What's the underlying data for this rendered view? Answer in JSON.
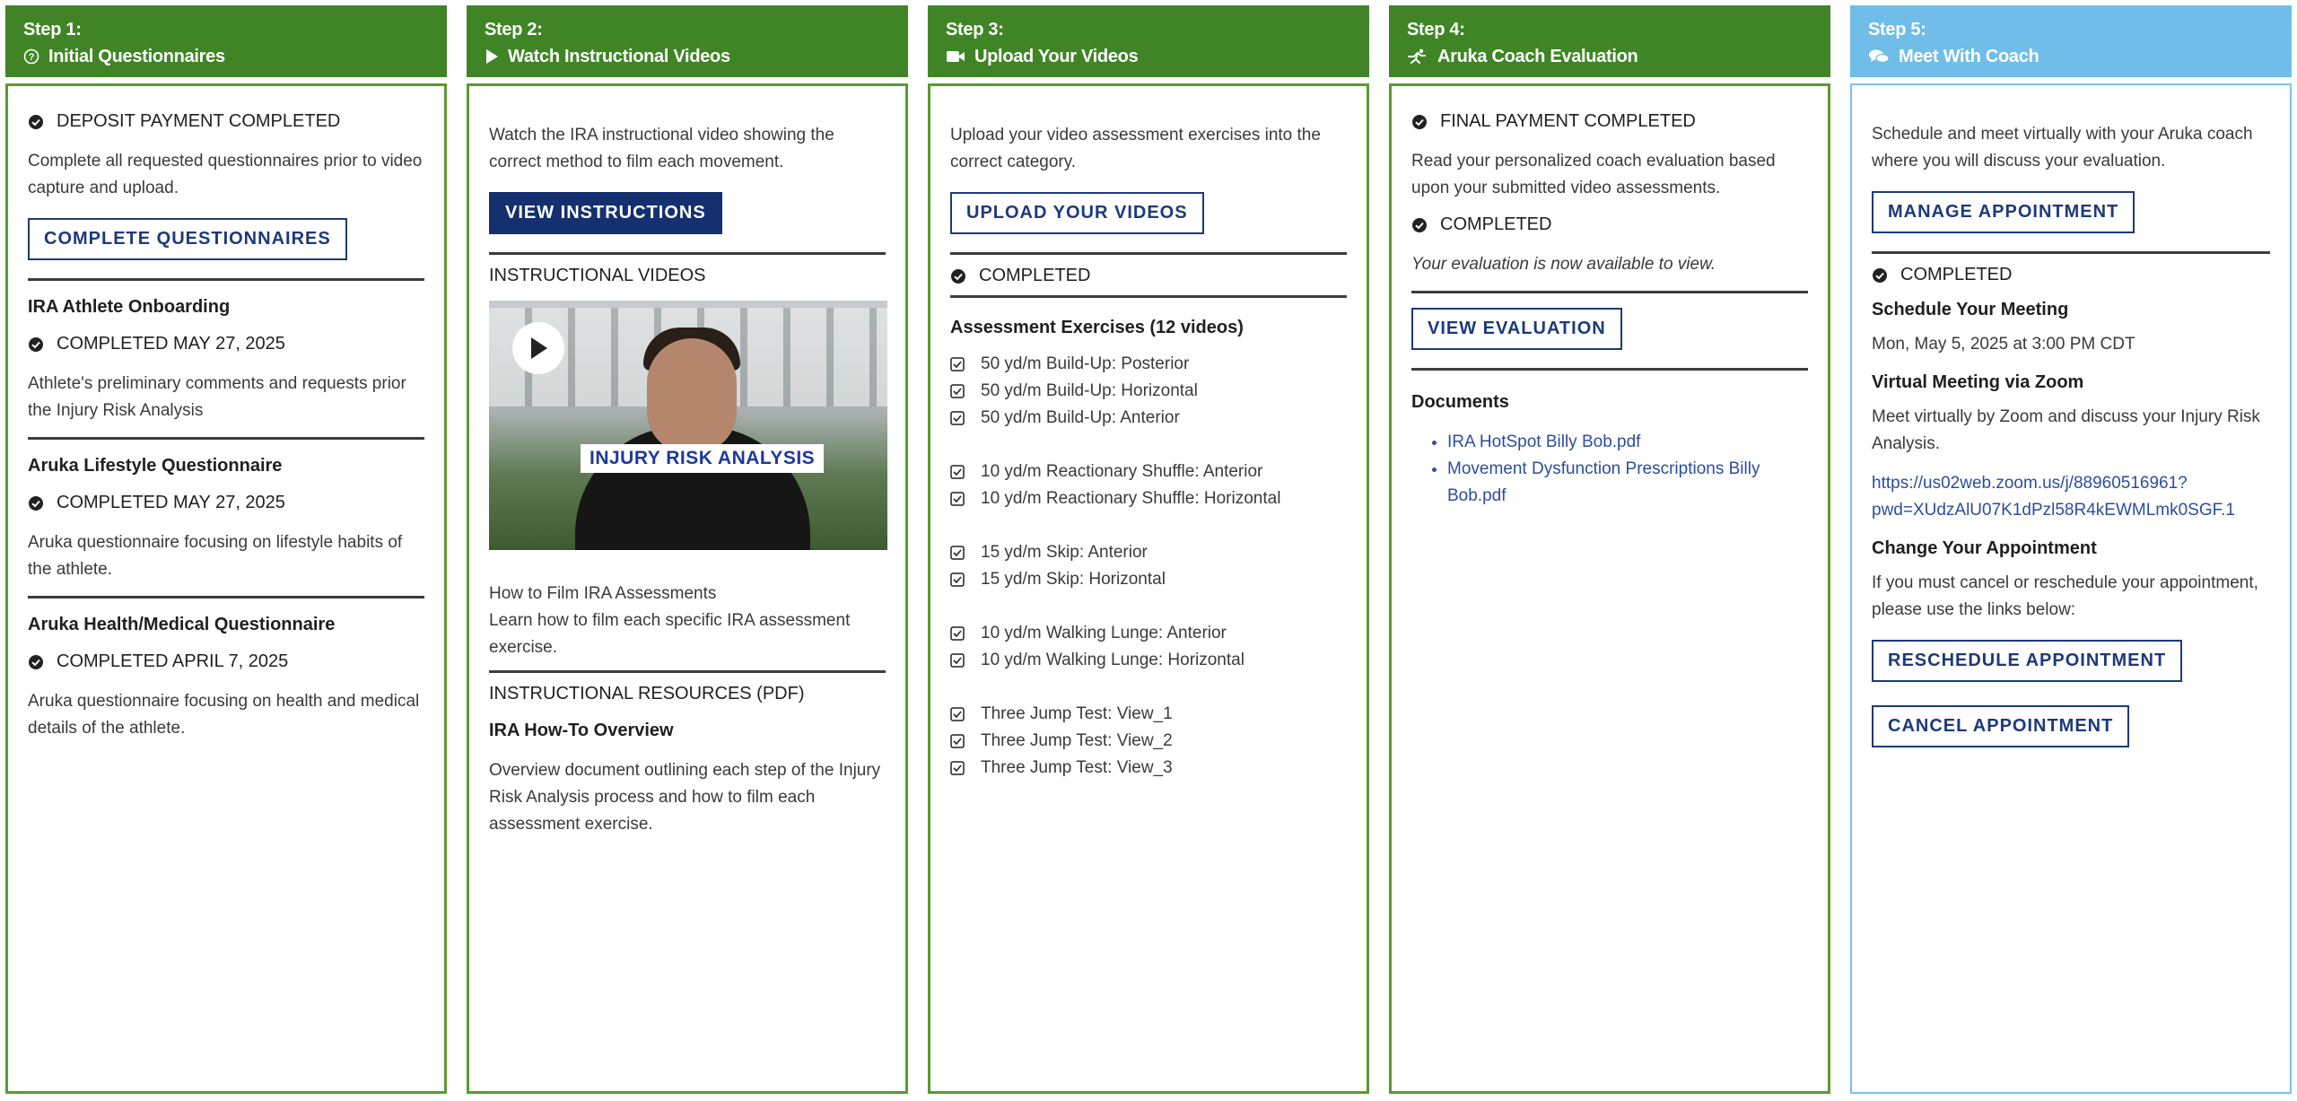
{
  "colors": {
    "green": "#3f8525",
    "blue": "#6fbde8",
    "button": "#1c3a7a",
    "link": "#2c4d9e"
  },
  "step1": {
    "step": "Step 1:",
    "title": "Initial Questionnaires",
    "icon": "question-circle-icon",
    "deposit": "DEPOSIT PAYMENT COMPLETED",
    "intro": "Complete all requested questionnaires prior to video capture and upload.",
    "button": "COMPLETE QUESTIONNAIRES",
    "items": [
      {
        "title": "IRA Athlete Onboarding",
        "status": "COMPLETED MAY 27, 2025",
        "desc": "Athlete's preliminary comments and requests prior the Injury Risk Analysis"
      },
      {
        "title": "Aruka Lifestyle Questionnaire",
        "status": "COMPLETED MAY 27, 2025",
        "desc": "Aruka questionnaire focusing on lifestyle habits of the athlete."
      },
      {
        "title": "Aruka Health/Medical Questionnaire",
        "status": "COMPLETED APRIL 7, 2025",
        "desc": "Aruka questionnaire focusing on health and medical details of the athlete."
      }
    ]
  },
  "step2": {
    "step": "Step 2:",
    "title": "Watch Instructional Videos",
    "icon": "play-icon",
    "intro": "Watch the IRA instructional video showing the correct method to film each movement.",
    "button": "VIEW INSTRUCTIONS",
    "videos_heading": "INSTRUCTIONAL VIDEOS",
    "video_caption": "INJURY RISK ANALYSIS",
    "video_title": "How to Film IRA Assessments",
    "video_desc": "Learn how to film each specific IRA assessment exercise.",
    "resources_heading": "INSTRUCTIONAL RESOURCES (PDF)",
    "resource_title": "IRA How-To Overview",
    "resource_desc": "Overview document outlining each step of the Injury Risk Analysis process and how to film each assessment exercise."
  },
  "step3": {
    "step": "Step 3:",
    "title": "Upload Your Videos",
    "icon": "video-camera-icon",
    "intro": "Upload your video assessment exercises into the correct category.",
    "button": "UPLOAD YOUR VIDEOS",
    "status": "COMPLETED",
    "exercises_heading": "Assessment Exercises (12 videos)",
    "exercises": [
      "50 yd/m Build-Up: Posterior",
      "50 yd/m Build-Up: Horizontal",
      "50 yd/m Build-Up: Anterior",
      "10 yd/m Reactionary Shuffle: Anterior",
      "10 yd/m Reactionary Shuffle: Horizontal",
      "15 yd/m Skip: Anterior",
      "15 yd/m Skip: Horizontal",
      "10 yd/m Walking Lunge: Anterior",
      "10 yd/m Walking Lunge: Horizontal",
      "Three Jump Test: View_1",
      "Three Jump Test: View_2",
      "Three Jump Test: View_3"
    ]
  },
  "step4": {
    "step": "Step 4:",
    "title": "Aruka Coach Evaluation",
    "icon": "runner-icon",
    "final": "FINAL PAYMENT COMPLETED",
    "intro": "Read your personalized coach evaluation based upon your submitted video assessments.",
    "status": "COMPLETED",
    "note": "Your evaluation is now available to view.",
    "button": "VIEW EVALUATION",
    "documents_heading": "Documents",
    "documents": [
      "IRA HotSpot Billy Bob.pdf",
      "Movement Dysfunction Prescriptions Billy Bob.pdf"
    ]
  },
  "step5": {
    "step": "Step 5:",
    "title": "Meet With Coach",
    "icon": "chat-bubbles-icon",
    "intro": "Schedule and meet virtually with your Aruka coach where you will discuss your evaluation.",
    "button": "MANAGE APPOINTMENT",
    "status": "COMPLETED",
    "schedule_heading": "Schedule Your Meeting",
    "schedule_value": "Mon, May 5, 2025 at 3:00 PM CDT",
    "zoom_heading": "Virtual Meeting via Zoom",
    "zoom_desc": "Meet virtually by Zoom and discuss your Injury Risk Analysis.",
    "zoom_link_1": "https://us02web.zoom.us/j/88960516961?",
    "zoom_link_2": "pwd=XUdzAlU07K1dPzl58R4kEWMLmk0SGF.1",
    "change_heading": "Change Your Appointment",
    "change_desc": "If you must cancel or reschedule your appointment, please use the links below:",
    "reschedule_button": "RESCHEDULE APPOINTMENT",
    "cancel_button": "CANCEL APPOINTMENT"
  }
}
